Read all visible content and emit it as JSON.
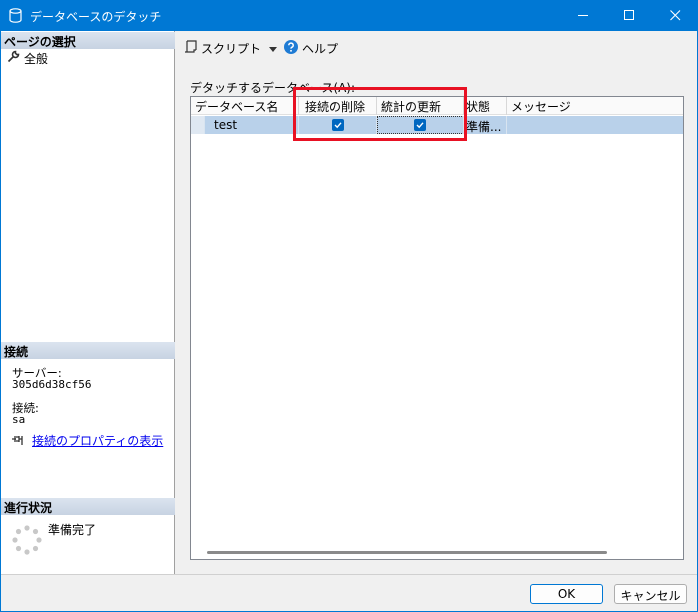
{
  "window": {
    "title": "データベースのデタッチ"
  },
  "left_panel": {
    "page_select_header": "ページの選択",
    "nav_items": [
      {
        "label": "全般",
        "icon": "wrench-icon"
      }
    ],
    "connection_header": "接続",
    "server_label": "サーバー:",
    "server_value": "305d6d38cf56",
    "connection_label": "接続:",
    "connection_value": "sa",
    "connection_props_link": "接続のプロパティの表示",
    "progress_header": "進行状況",
    "progress_status": "準備完了"
  },
  "toolbar": {
    "script_label": "スクリプト",
    "help_label": "ヘルプ"
  },
  "grid": {
    "label": "デタッチするデータベース(A):",
    "columns": [
      "データベース名",
      "接続の削除",
      "統計の更新",
      "状態",
      "メッセージ"
    ],
    "rows": [
      {
        "database_name": "test",
        "drop_connections": true,
        "update_statistics": true,
        "status": "準備...",
        "message": ""
      }
    ]
  },
  "buttons": {
    "ok": "OK",
    "cancel": "キャンセル"
  },
  "colors": {
    "titlebar": "#0078d4",
    "section_header": "#c7d3e2",
    "selected_row": "#b9d1ea",
    "checkbox": "#0067c0",
    "highlight_box": "#e81123",
    "link": "#0000ee"
  }
}
